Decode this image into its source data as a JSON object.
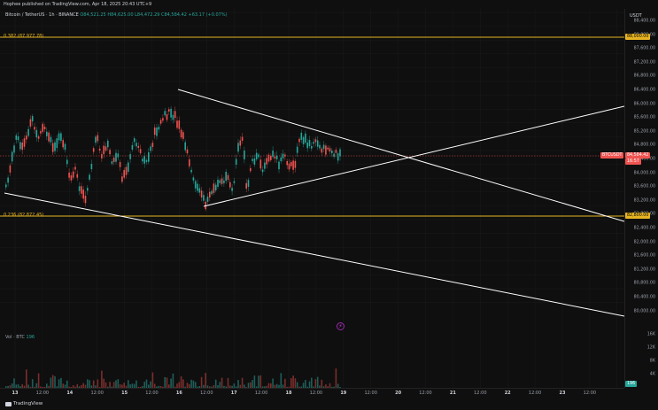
{
  "header": {
    "published": "Hophee published on TradingView.com, Apr 18, 2025 20:43 UTC+9"
  },
  "legend": {
    "symbol": "Bitcoin / TetherUS · 1h · BINANCE",
    "open": "O84,521.25",
    "high": "H84,625.00",
    "low": "L84,472.29",
    "close": "C84,584.42",
    "change": "+63.17 (+0.07%)"
  },
  "axis": {
    "currency": "USDT",
    "price_labels": [
      "88,400.00",
      "88,000.00",
      "87,600.00",
      "87,200.00",
      "86,800.00",
      "86,400.00",
      "86,000.00",
      "85,600.00",
      "85,200.00",
      "84,800.00",
      "84,400.00",
      "84,000.00",
      "83,600.00",
      "83,200.00",
      "82,800.00",
      "82,400.00",
      "82,000.00",
      "81,600.00",
      "81,200.00",
      "80,800.00",
      "80,400.00",
      "80,000.00"
    ],
    "volume_labels": [
      "16K",
      "12K",
      "8K",
      "4K"
    ],
    "time_labels": [
      "13",
      "12:00",
      "14",
      "12:00",
      "15",
      "12:00",
      "16",
      "12:00",
      "17",
      "12:00",
      "18",
      "12:00",
      "19",
      "12:00",
      "20",
      "12:00",
      "21",
      "12:00",
      "22",
      "12:00",
      "23",
      "12:00"
    ]
  },
  "price_tag": {
    "symbol": "BTCUSDT",
    "price": "84,584.42",
    "countdown": "16:57"
  },
  "volume_tag": "196",
  "fib": [
    {
      "label": "0.382 (87,977.78)",
      "tag": "88,000.00"
    },
    {
      "label": "0.236 (82,872.45)",
      "tag": "82,800.00"
    }
  ],
  "volume_legend": {
    "label": "Vol · BTC",
    "value": "196"
  },
  "footer": {
    "brand": "TradingView"
  },
  "colors": {
    "up": "#26a69a",
    "down": "#ef5350",
    "fib": "#e6b422",
    "line": "#ffffff"
  },
  "icons": {
    "alert": "lightning-icon",
    "logo": "tradingview-logo-icon"
  }
}
